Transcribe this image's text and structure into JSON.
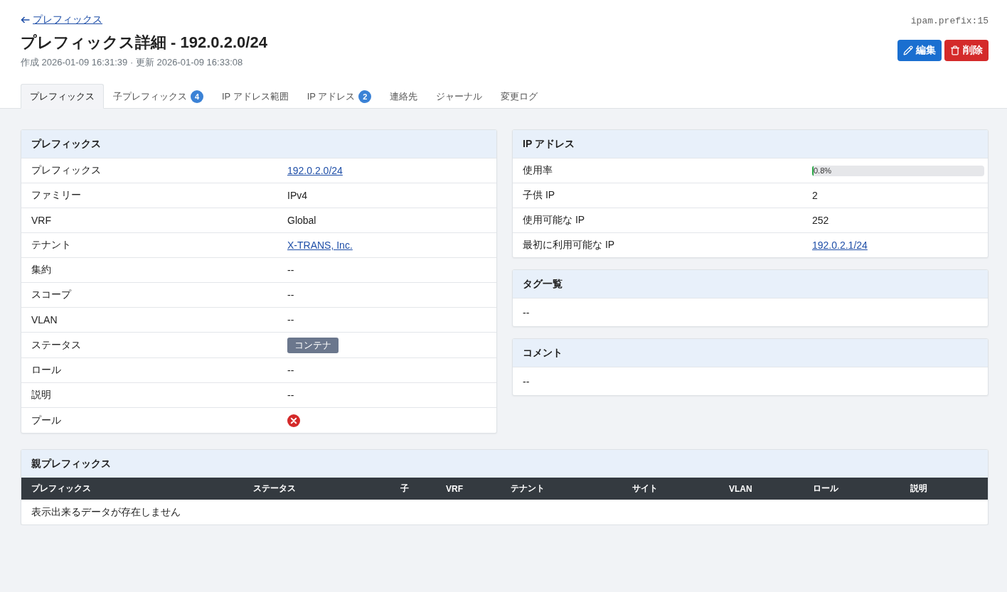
{
  "back_link": {
    "label": "プレフィックス"
  },
  "object_id": "ipam.prefix:15",
  "title": "プレフィックス詳細 - 192.0.2.0/24",
  "meta": "作成 2026-01-09 16:31:39 · 更新 2026-01-09 16:33:08",
  "actions": [
    {
      "kind": "edit",
      "label": "編集"
    },
    {
      "kind": "delete",
      "label": "削除"
    }
  ],
  "tabs": [
    {
      "label": "プレフィックス",
      "selected": true
    },
    {
      "label": "子プレフィックス",
      "badge": "4",
      "selected": false
    },
    {
      "label": "IP アドレス範囲",
      "selected": false
    },
    {
      "label": "IP アドレス",
      "badge": "2",
      "selected": false
    },
    {
      "label": "連絡先",
      "selected": false
    },
    {
      "label": "ジャーナル",
      "selected": false
    },
    {
      "label": "変更ログ",
      "selected": false
    }
  ],
  "prefix_panel": {
    "title": "プレフィックス",
    "rows": [
      {
        "label": "プレフィックス",
        "kind": "link",
        "value": "192.0.2.0/24"
      },
      {
        "label": "ファミリー",
        "kind": "text",
        "value": "IPv4"
      },
      {
        "label": "VRF",
        "kind": "text",
        "value": "Global"
      },
      {
        "label": "テナント",
        "kind": "link",
        "value": "X-TRANS, Inc."
      },
      {
        "label": "集約",
        "kind": "text",
        "value": "--"
      },
      {
        "label": "スコープ",
        "kind": "text",
        "value": "--"
      },
      {
        "label": "VLAN",
        "kind": "text",
        "value": "--"
      },
      {
        "label": "ステータス",
        "kind": "badge",
        "value": "コンテナ"
      },
      {
        "label": "ロール",
        "kind": "text",
        "value": "--"
      },
      {
        "label": "説明",
        "kind": "text",
        "value": "--"
      },
      {
        "label": "プール",
        "kind": "boolean",
        "on": false
      }
    ]
  },
  "ip_panel": {
    "title": "IP アドレス",
    "rows": [
      {
        "label": "使用率",
        "kind": "meter",
        "level": 0.008,
        "reading": "0.8%"
      },
      {
        "label": "子供 IP",
        "kind": "text",
        "value": "2"
      },
      {
        "label": "使用可能な IP",
        "kind": "text",
        "value": "252"
      },
      {
        "label": "最初に利用可能な IP",
        "kind": "link",
        "value": "192.0.2.1/24"
      }
    ]
  },
  "tags_panel": {
    "title": "タグ一覧",
    "value": "--"
  },
  "comment_panel": {
    "title": "コメント",
    "value": "--"
  },
  "parent_prefixes": {
    "title": "親プレフィックス",
    "columns": [
      "プレフィックス",
      "ステータス",
      "子",
      "VRF",
      "テナント",
      "サイト",
      "VLAN",
      "ロール",
      "説明"
    ],
    "empty_message": "表示出来るデータが存在しません"
  }
}
